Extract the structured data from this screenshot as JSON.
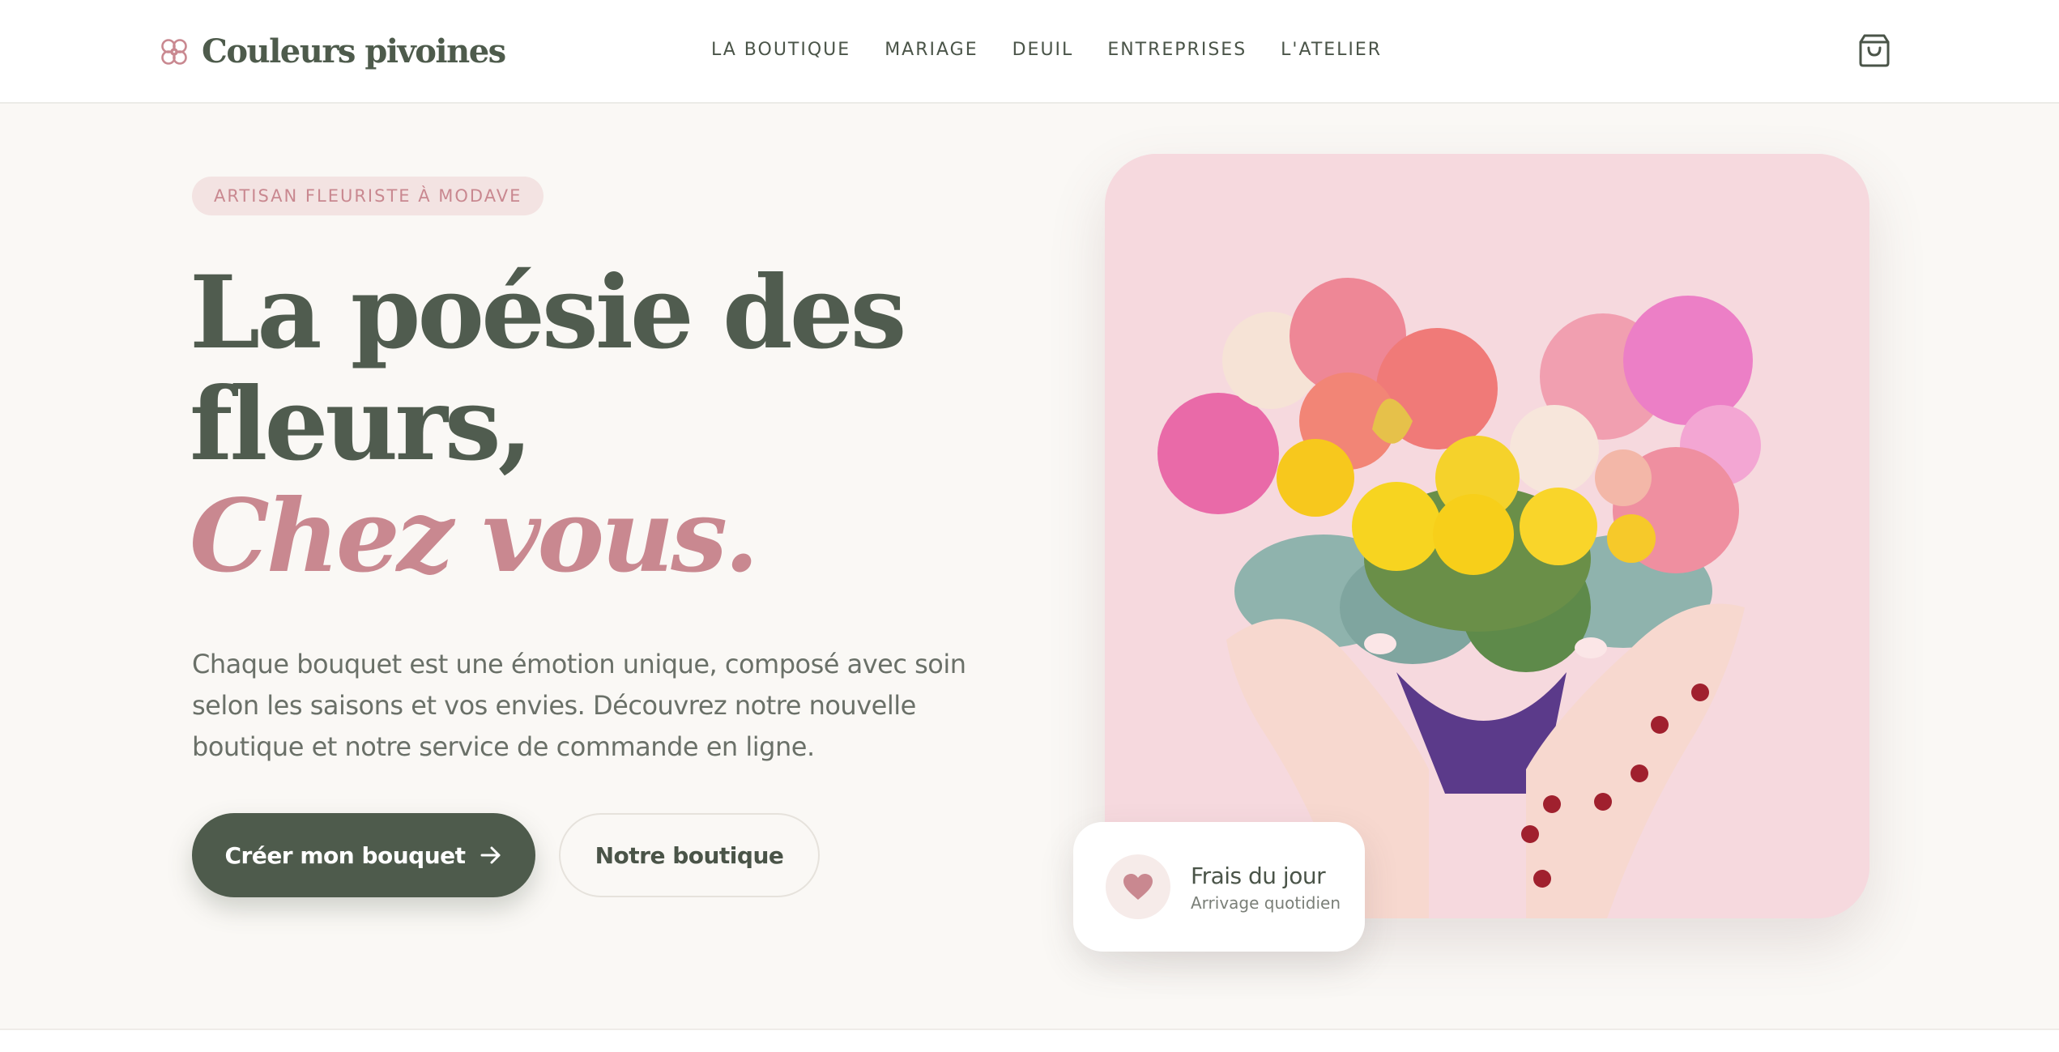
{
  "brand": {
    "name": "Couleurs pivoines",
    "logo_icon": "flower-icon",
    "accent": "#c98890",
    "primary": "#4e5b4c"
  },
  "nav": {
    "items": [
      "LA BOUTIQUE",
      "MARIAGE",
      "DEUIL",
      "ENTREPRISES",
      "L'ATELIER"
    ],
    "cart_icon": "shopping-bag-icon"
  },
  "hero": {
    "badge": "ARTISAN FLEURISTE À MODAVE",
    "headline": {
      "line1": "La poésie des",
      "line2": "fleurs,",
      "accent": "Chez vous."
    },
    "lead": "Chaque bouquet est une émotion unique, composé avec soin selon les saisons et vos envies. Découvrez notre nouvelle boutique et notre service de commande en ligne.",
    "primary_button": "Créer mon bouquet",
    "primary_button_icon": "arrow-right-icon",
    "secondary_button": "Notre boutique"
  },
  "fresh_card": {
    "title": "Frais du jour",
    "subtitle": "Arrivage quotidien",
    "icon": "heart-icon"
  }
}
